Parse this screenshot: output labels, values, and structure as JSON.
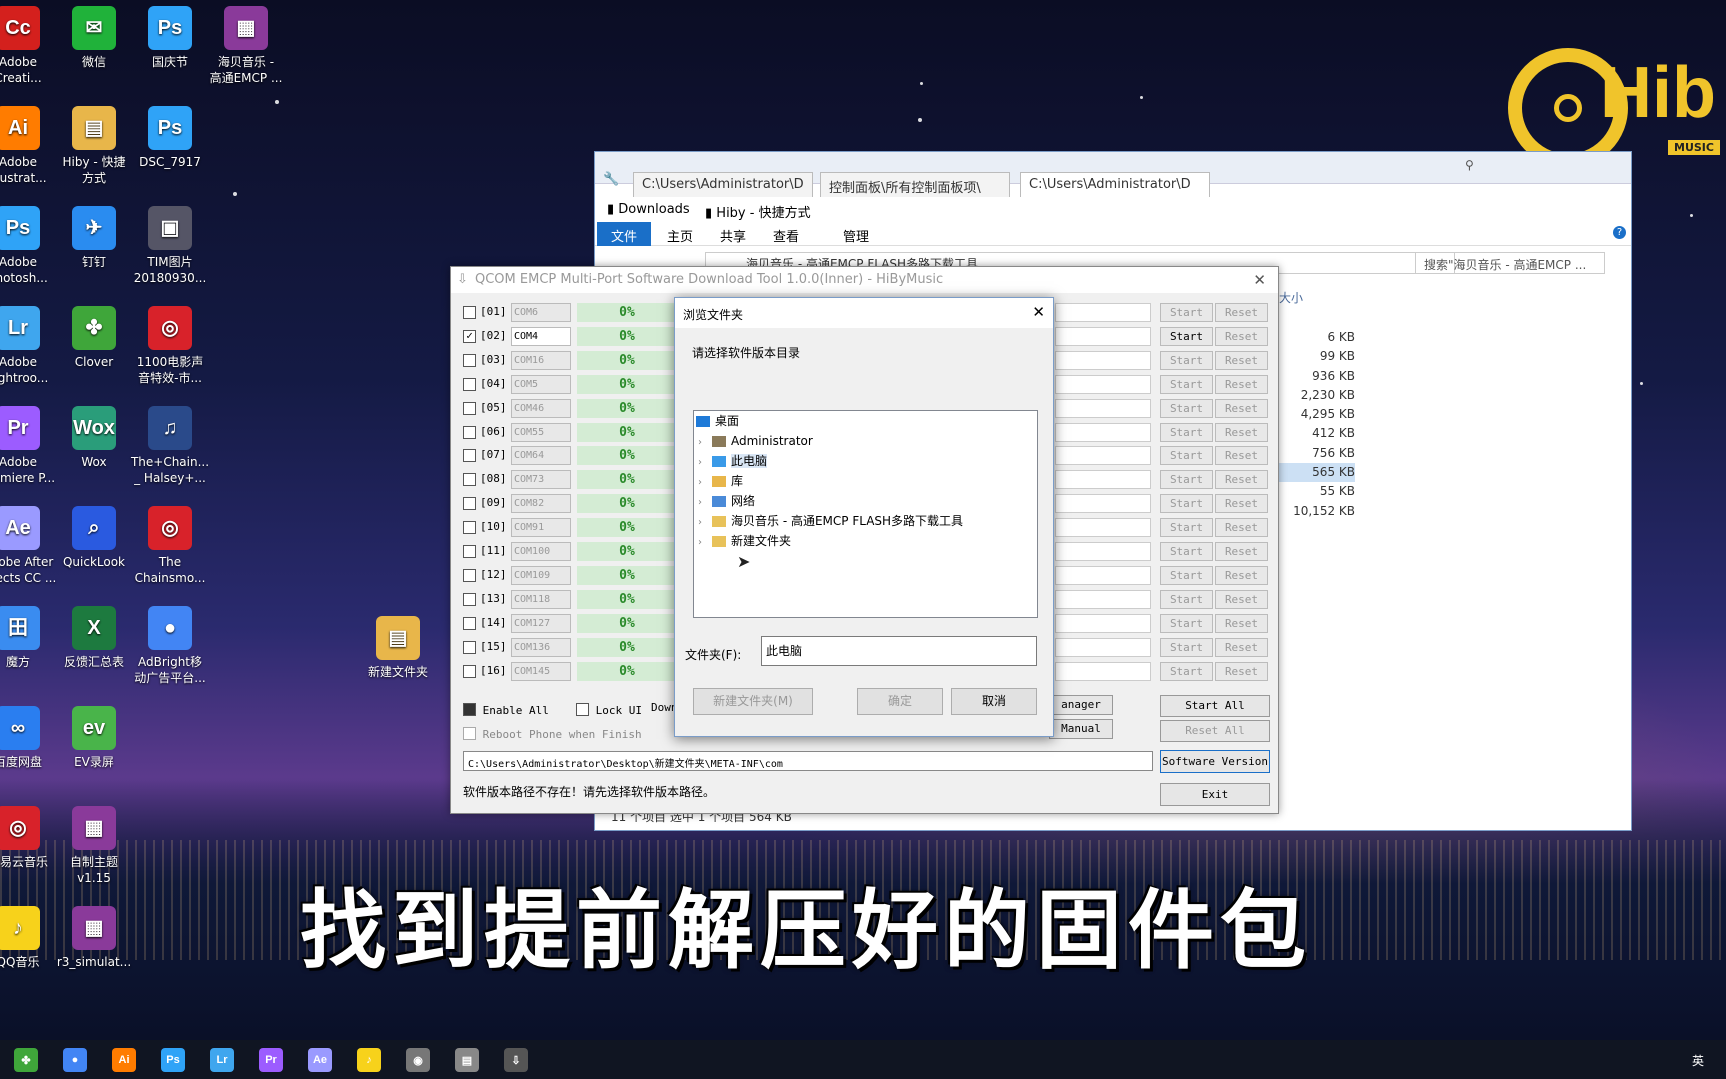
{
  "desktop": {
    "icons": [
      {
        "label": "Adobe\nCreati...",
        "glyph": "Cc",
        "color": "#d4201d"
      },
      {
        "label": "Adobe\nIllustrat...",
        "glyph": "Ai",
        "color": "#ff7c00"
      },
      {
        "label": "Adobe\nPhotosh...",
        "glyph": "Ps",
        "color": "#2fa3f7"
      },
      {
        "label": "Adobe\nLightroo...",
        "glyph": "Lr",
        "color": "#3fa6ee"
      },
      {
        "label": "Adobe\nPremiere P...",
        "glyph": "Pr",
        "color": "#9c5cff"
      },
      {
        "label": "Adobe After\nEffects CC ...",
        "glyph": "Ae",
        "color": "#9a9aff"
      },
      {
        "label": "魔方",
        "glyph": "田",
        "color": "#3a8cf0"
      },
      {
        "label": "百度网盘",
        "glyph": "∞",
        "color": "#2a7ef0"
      },
      {
        "label": "网易云音乐",
        "glyph": "◎",
        "color": "#d8222a"
      },
      {
        "label": "QQ音乐",
        "glyph": "♪",
        "color": "#f7d21b"
      },
      {
        "label": "微信",
        "glyph": "✉",
        "color": "#20b23a"
      },
      {
        "label": "Hiby - 快捷\n方式",
        "glyph": "▤",
        "color": "#e8b64a"
      },
      {
        "label": "钉钉",
        "glyph": "✈",
        "color": "#2a8cf0"
      },
      {
        "label": "Clover",
        "glyph": "✤",
        "color": "#3fa63a"
      },
      {
        "label": "Wox",
        "glyph": "Wox",
        "color": "#2a9d7a"
      },
      {
        "label": "QuickLook",
        "glyph": "⌕",
        "color": "#2a5ae0"
      },
      {
        "label": "反馈汇总表",
        "glyph": "X",
        "color": "#1d7a3f"
      },
      {
        "label": "EV录屏",
        "glyph": "ev",
        "color": "#49b44a"
      },
      {
        "label": "自制主题\nv1.15",
        "glyph": "▦",
        "color": "#8a3a9a"
      },
      {
        "label": "r3_simulat...",
        "glyph": "▦",
        "color": "#8a3a9a"
      },
      {
        "label": "国庆节",
        "glyph": "Ps",
        "color": "#2fa3f7"
      },
      {
        "label": "DSC_7917",
        "glyph": "Ps",
        "color": "#2fa3f7"
      },
      {
        "label": "TIM图片\n20180930...",
        "glyph": "▣",
        "color": "#556"
      },
      {
        "label": "1100电影声\n音特效-市...",
        "glyph": "◎",
        "color": "#d8222a"
      },
      {
        "label": "The+Chain...\n_ Halsey+...",
        "glyph": "♫",
        "color": "#2a4a8a"
      },
      {
        "label": "The\nChainsmo...",
        "glyph": "◎",
        "color": "#d8222a"
      },
      {
        "label": "AdBright移\n动广告平台...",
        "glyph": "●",
        "color": "#4285f4"
      },
      {
        "label": "海贝音乐 -\n高通EMCP ...",
        "glyph": "▦",
        "color": "#8a3a9a"
      },
      {
        "label": "新建文件夹",
        "glyph": "▤",
        "color": "#e8b64a"
      }
    ]
  },
  "logo": {
    "text": "Hib",
    "sub": "MUSIC"
  },
  "explorer": {
    "tabs": [
      "C:\\Users\\Administrator\\D",
      "控制面板\\所有控制面板项\\",
      "C:\\Users\\Administrator\\D"
    ],
    "favorites": [
      "Downloads",
      "Hiby - 快捷方式"
    ],
    "ribbon": [
      "文件",
      "主页",
      "共享",
      "查看",
      "管理"
    ],
    "address": "海贝音乐 - 高通EMCP FLASH多路下载工具",
    "search_placeholder": "搜索\"海贝音乐 - 高通EMCP ...",
    "size_header": "大小",
    "sizes": [
      "6 KB",
      "99 KB",
      "936 KB",
      "2,230 KB",
      "4,295 KB",
      "412 KB",
      "756 KB",
      "565 KB",
      "55 KB",
      "10,152 KB"
    ],
    "status": "11 个项目    选中 1 个项目  564 KB"
  },
  "tool": {
    "title": "QCOM EMCP Multi-Port Software Download Tool 1.0.0(Inner) - HiByMusic",
    "rows": [
      {
        "id": "[01]",
        "port": "COM6",
        "pct": "0%",
        "checked": false
      },
      {
        "id": "[02]",
        "port": "COM4",
        "pct": "0%",
        "checked": true
      },
      {
        "id": "[03]",
        "port": "COM16",
        "pct": "0%",
        "checked": false
      },
      {
        "id": "[04]",
        "port": "COM5",
        "pct": "0%",
        "checked": false
      },
      {
        "id": "[05]",
        "port": "COM46",
        "pct": "0%",
        "checked": false
      },
      {
        "id": "[06]",
        "port": "COM55",
        "pct": "0%",
        "checked": false
      },
      {
        "id": "[07]",
        "port": "COM64",
        "pct": "0%",
        "checked": false
      },
      {
        "id": "[08]",
        "port": "COM73",
        "pct": "0%",
        "checked": false
      },
      {
        "id": "[09]",
        "port": "COM82",
        "pct": "0%",
        "checked": false
      },
      {
        "id": "[10]",
        "port": "COM91",
        "pct": "0%",
        "checked": false
      },
      {
        "id": "[11]",
        "port": "COM100",
        "pct": "0%",
        "checked": false
      },
      {
        "id": "[12]",
        "port": "COM109",
        "pct": "0%",
        "checked": false
      },
      {
        "id": "[13]",
        "port": "COM118",
        "pct": "0%",
        "checked": false
      },
      {
        "id": "[14]",
        "port": "COM127",
        "pct": "0%",
        "checked": false
      },
      {
        "id": "[15]",
        "port": "COM136",
        "pct": "0%",
        "checked": false
      },
      {
        "id": "[16]",
        "port": "COM145",
        "pct": "0%",
        "checked": false
      }
    ],
    "start_label": "Start",
    "reset_label": "Reset",
    "enable_all": "Enable All",
    "lock_ui": "Lock UI",
    "download_partial": "Down",
    "reboot": "Reboot Phone when Finish",
    "manager_partial": "anager",
    "manual_partial": "Manual",
    "start_all": "Start All",
    "reset_all": "Reset All",
    "path": "C:\\Users\\Administrator\\Desktop\\新建文件夹\\META-INF\\com",
    "software_version": "Software Version",
    "exit": "Exit",
    "status_msg": "软件版本路径不存在！请先选择软件版本路径。"
  },
  "dialog": {
    "title": "浏览文件夹",
    "prompt": "请选择软件版本目录",
    "tree": [
      {
        "label": "桌面",
        "level": 0,
        "icon": "#1e7ad8"
      },
      {
        "label": "Administrator",
        "level": 1,
        "icon": "#8a7a5a"
      },
      {
        "label": "此电脑",
        "level": 1,
        "icon": "#3a9ae8"
      },
      {
        "label": "库",
        "level": 1,
        "icon": "#e8b64a"
      },
      {
        "label": "网络",
        "level": 1,
        "icon": "#4a8ad8"
      },
      {
        "label": "海贝音乐 - 高通EMCP FLASH多路下载工具",
        "level": 1,
        "icon": "#e8c25a"
      },
      {
        "label": "新建文件夹",
        "level": 1,
        "icon": "#e8c25a"
      }
    ],
    "folder_label": "文件夹(F):",
    "folder_value": "此电脑",
    "new_folder": "新建文件夹(M)",
    "ok": "确定",
    "cancel": "取消"
  },
  "subtitle": "找到提前解压好的固件包",
  "taskbar": {
    "apps": [
      {
        "glyph": "✤",
        "color": "#3fa63a"
      },
      {
        "glyph": "●",
        "color": "#4285f4"
      },
      {
        "glyph": "Ai",
        "color": "#ff7c00"
      },
      {
        "glyph": "Ps",
        "color": "#2fa3f7"
      },
      {
        "glyph": "Lr",
        "color": "#3fa6ee"
      },
      {
        "glyph": "Pr",
        "color": "#9c5cff"
      },
      {
        "glyph": "Ae",
        "color": "#9a9aff"
      },
      {
        "glyph": "♪",
        "color": "#f7d21b"
      },
      {
        "glyph": "◉",
        "color": "#777"
      },
      {
        "glyph": "▤",
        "color": "#888"
      },
      {
        "glyph": "⇩",
        "color": "#555"
      }
    ],
    "ime": "英"
  }
}
